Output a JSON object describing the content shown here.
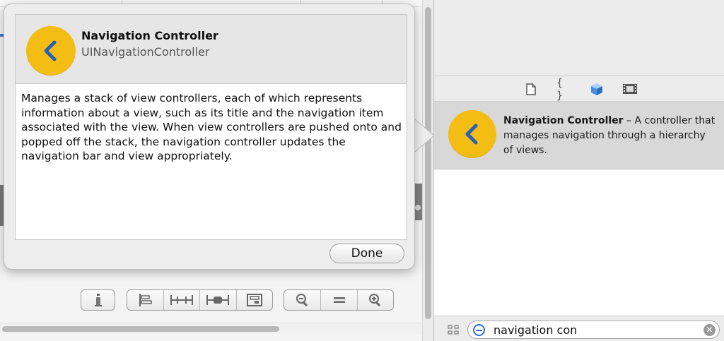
{
  "popover": {
    "title": "Navigation Controller",
    "class_name": "UINavigationController",
    "icon": "chevron-left-icon",
    "description": "Manages a stack of view controllers, each of which represents information about a view, such as its title and the navigation item associated with the view. When view controllers are pushed onto and popped off the stack, the navigation controller updates the navigation bar and view appropriately.",
    "done_label": "Done"
  },
  "library": {
    "tabs": [
      {
        "name": "file-template-icon"
      },
      {
        "name": "code-snippet-icon",
        "glyph": "{ }"
      },
      {
        "name": "object-library-icon"
      },
      {
        "name": "media-library-icon"
      }
    ],
    "selected_tab": "object-library-icon",
    "items": [
      {
        "title": "Navigation Controller",
        "separator": " – A",
        "description": "controller that manages navigation through a hierarchy of views.",
        "icon": "chevron-left-icon"
      }
    ],
    "filter": {
      "value": "navigation con"
    }
  },
  "canvas_toolbar": {
    "groups": [
      [
        "issues-icon"
      ],
      [
        "align-icon",
        "pin-icon",
        "resolve-layout-icon",
        "resize-icon"
      ],
      [
        "zoom-out-icon",
        "actual-size-icon",
        "zoom-in-icon"
      ]
    ]
  },
  "colors": {
    "icon_yellow": "#f3bd14",
    "icon_chevron": "#2b5fb5",
    "selection_gray": "#d8d8d8",
    "accent_blue": "#2d6ed8"
  }
}
